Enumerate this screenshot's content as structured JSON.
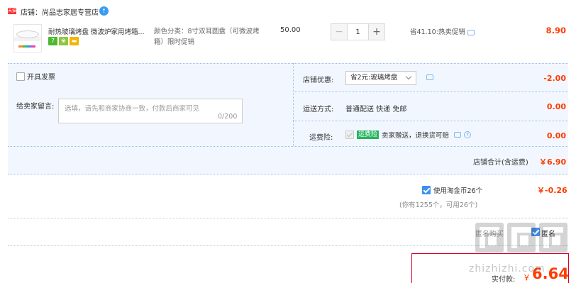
{
  "shop": {
    "badge": "天猫",
    "label": "店铺：尚品志家居专营店"
  },
  "item": {
    "title": "耐热玻璃烤盘 微波炉家用烤箱...",
    "sku": "颜色分类：8寸双耳圆盘（可微波烤箱）限时促销",
    "unit_price": "50.00",
    "quantity": "1",
    "minus": "−",
    "plus": "+",
    "promo": "省41.10:热卖促销",
    "total": "8.90",
    "services": [
      "7",
      "❀",
      "▬"
    ]
  },
  "invoice": {
    "label": "开具发票"
  },
  "message": {
    "label": "给卖家留言:",
    "placeholder": "选填，请先和商家协商一致，付款后商家可见",
    "count": "0/200"
  },
  "discount": {
    "label": "店铺优惠:",
    "selected": "省2元:玻璃烤盘",
    "value": "-2.00"
  },
  "shipping": {
    "label": "运送方式:",
    "method": "普通配送 快递 免邮",
    "value": "0.00"
  },
  "insurance": {
    "label": "运费险:",
    "tag": "运费险",
    "text": "卖家赠送，退换货可赔",
    "help": "?",
    "value": "0.00"
  },
  "subtotal": {
    "label": "店铺合计(含运费)",
    "value": "￥6.90"
  },
  "coins": {
    "label": "使用淘金币26个",
    "value": "￥-0.26",
    "note": "(你有1255个，可用26个)"
  },
  "options": {
    "anonymous": "匿名购买",
    "other": "匿名"
  },
  "pay": {
    "label": "实付款:",
    "currency": "￥",
    "value": "6.64"
  },
  "watermark": {
    "text": "zhizhizhi.com"
  },
  "colors": {
    "accent": "#ff3c00",
    "panel_bg": "#f2f7ff",
    "border_red": "#d9002b"
  }
}
